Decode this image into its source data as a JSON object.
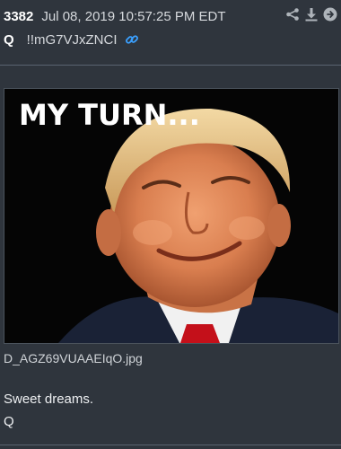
{
  "post": {
    "number": "3382",
    "timestamp": "Jul 08, 2019 10:57:25 PM EDT",
    "author": "Q",
    "tripcode": "!!mG7VJxZNCI"
  },
  "actions": {
    "icons": [
      "share-icon",
      "download-icon",
      "next-arrow-icon"
    ]
  },
  "image": {
    "overlay_text": "MY TURN...",
    "filename": "D_AGZ69VUAAEIqO.jpg"
  },
  "message": {
    "line1": "Sweet dreams.",
    "signature": "Q"
  },
  "colors": {
    "background": "#2f353d",
    "link_blue": "#3aa0ff",
    "icon_gray": "#aeb4ba"
  }
}
